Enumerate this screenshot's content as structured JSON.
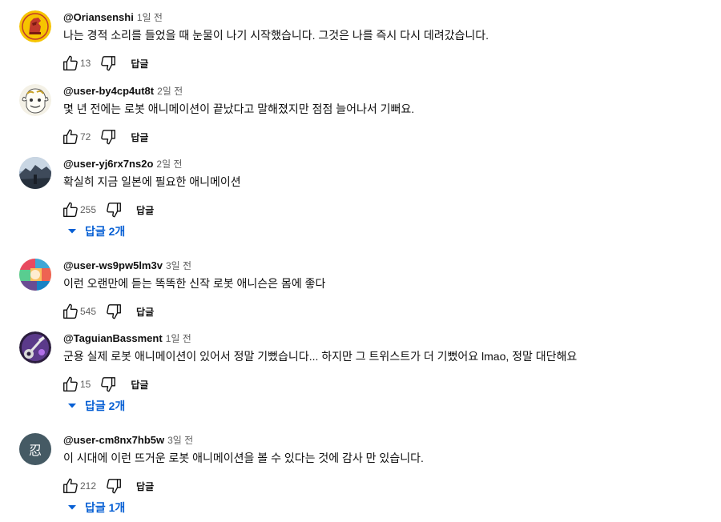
{
  "comments": [
    {
      "author": "@Oriansenshi",
      "time": "1일 전",
      "text": "나는 경적 소리를 들었을 때 눈물이 나기 시작했습니다. 그것은 나를 즉시 다시 데려갔습니다.",
      "likes": "13",
      "reply_label": "답글",
      "avatar_icon": "emblem-avatar"
    },
    {
      "author": "@user-by4cp4ut8t",
      "time": "2일 전",
      "text": "몇 년 전에는 로봇 애니메이션이 끝났다고 말해졌지만 점점 늘어나서 기뻐요.",
      "likes": "72",
      "reply_label": "답글",
      "avatar_icon": "cartoon-face-avatar"
    },
    {
      "author": "@user-yj6rx7ns2o",
      "time": "2일 전",
      "text": "확실히 지금 일본에 필요한 애니메이션",
      "likes": "255",
      "reply_label": "답글",
      "replies_label": "답글 2개",
      "avatar_icon": "landscape-photo-avatar"
    },
    {
      "author": "@user-ws9pw5lm3v",
      "time": "3일 전",
      "text": "이런 오랜만에 듣는 똑똑한 신작 로봇 애니슨은 몸에 좋다",
      "likes": "545",
      "reply_label": "답글",
      "avatar_icon": "colorful-collage-avatar"
    },
    {
      "author": "@TaguianBassment",
      "time": "1일 전",
      "text": "군용 실제 로봇 애니메이션이 있어서 정말 기뻤습니다... 하지만 그 트위스트가 더 기뻤어요 lmao, 정말 대단해요",
      "likes": "15",
      "reply_label": "답글",
      "replies_label": "답글 2개",
      "avatar_icon": "guitar-art-avatar"
    },
    {
      "author": "@user-cm8nx7hb5w",
      "time": "3일 전",
      "text": "이 시대에 이런 뜨거운 로봇 애니메이션을 볼 수 있다는 것에 감사 만 있습니다.",
      "likes": "212",
      "reply_label": "답글",
      "replies_label": "답글 1개",
      "avatar_letter": "忍",
      "avatar_icon": "letter-avatar"
    }
  ],
  "colors": {
    "text": "#0f0f0f",
    "secondary": "#606060",
    "link": "#065fd4",
    "letter_avatar_bg": "#455a64"
  }
}
